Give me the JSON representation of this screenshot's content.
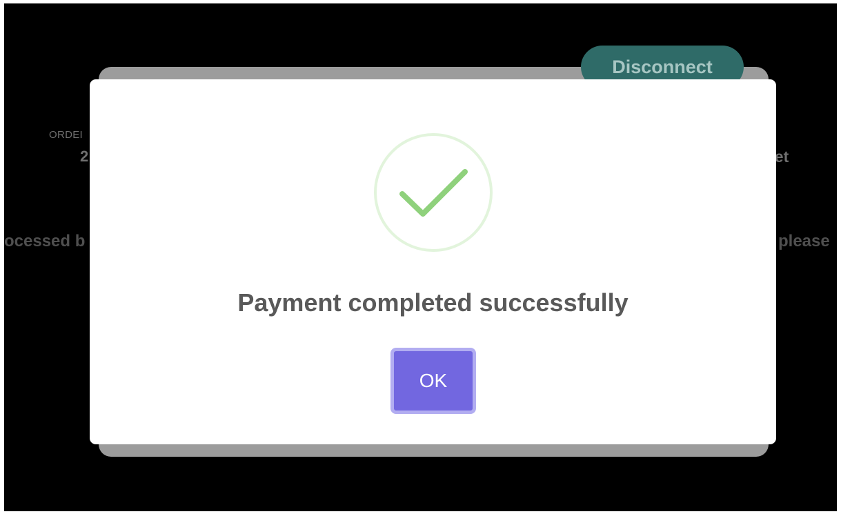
{
  "background": {
    "disconnect_label": "Disconnect",
    "order_label_fragment": "ORDEI",
    "order_value_fragment": "2",
    "wallet_fragment": "llet",
    "processed_fragment": "ocessed b",
    "please_fragment": "please"
  },
  "modal": {
    "icon": "checkmark-circle-icon",
    "title": "Payment completed successfully",
    "ok_label": "OK"
  },
  "colors": {
    "overlay": "#000000",
    "modal_background": "#ffffff",
    "success_green": "#8fd17c",
    "success_ring": "#e2f4dc",
    "button_primary": "#7267e0",
    "button_focus_ring": "#b2adf1",
    "disconnect_bg": "#2f6b68"
  }
}
